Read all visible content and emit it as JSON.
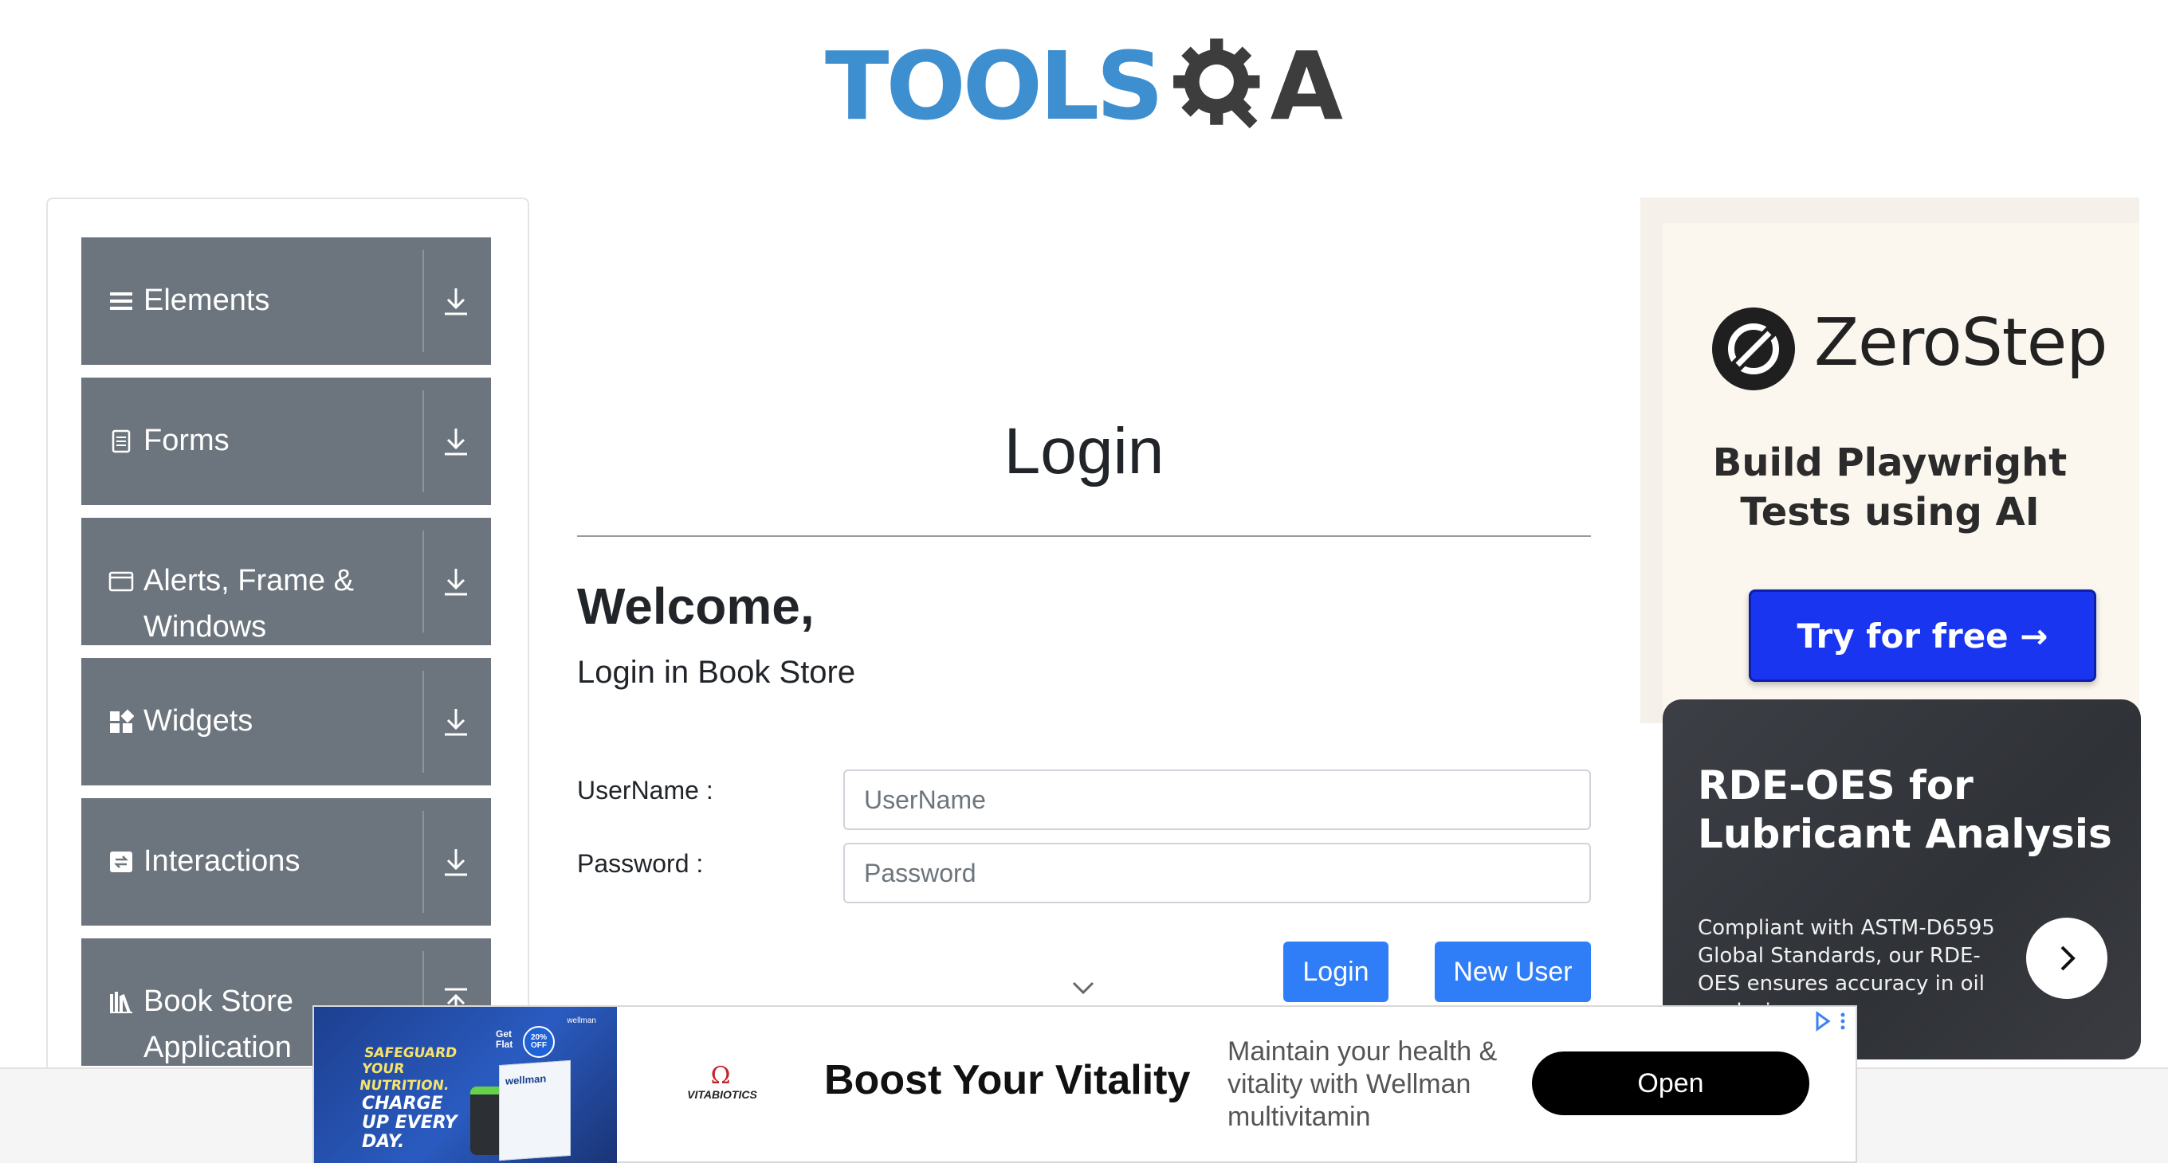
{
  "header": {
    "logo_text_left": "TOOLS",
    "logo_text_right": "A"
  },
  "sidebar": {
    "groups": [
      {
        "label": "Elements",
        "icon": "list-icon"
      },
      {
        "label": "Forms",
        "icon": "form-icon"
      },
      {
        "label": "Alerts, Frame & Windows",
        "icon": "window-icon"
      },
      {
        "label": "Widgets",
        "icon": "widgets-icon"
      },
      {
        "label": "Interactions",
        "icon": "interactions-icon"
      },
      {
        "label": "Book Store Application",
        "icon": "books-icon"
      }
    ]
  },
  "main": {
    "title": "Login",
    "welcome": "Welcome,",
    "subtitle": "Login in Book Store",
    "username_label": "UserName :",
    "username_placeholder": "UserName",
    "password_label": "Password :",
    "password_placeholder": "Password",
    "login_button": "Login",
    "new_user_button": "New User"
  },
  "ads": {
    "zerostep": {
      "name": "ZeroStep",
      "tagline": "Build Playwright Tests using AI",
      "cta": "Try for free →"
    },
    "rde": {
      "title": "RDE-OES for Lubricant Analysis",
      "text": "Compliant with ASTM-D6595 Global Standards, our RDE-OES ensures accuracy in oil analysis"
    },
    "banner": {
      "image_brand": "wellman",
      "image_line1": "SAFEGUARD YOUR NUTRITION.",
      "image_line2": "CHARGE UP EVERY DAY.",
      "image_promo": "Get Flat",
      "image_badge": "20% OFF",
      "image_box_label": "wellman",
      "advertiser": "VITABIOTICS",
      "headline": "Boost Your Vitality",
      "description": "Maintain your health & vitality with Wellman multivitamin",
      "cta": "Open"
    }
  },
  "colors": {
    "sidebar_group_bg": "#6c757d",
    "primary_button": "#2f7ef7",
    "logo_blue": "#3e8fd0",
    "zerostep_button": "#1a35f0"
  }
}
